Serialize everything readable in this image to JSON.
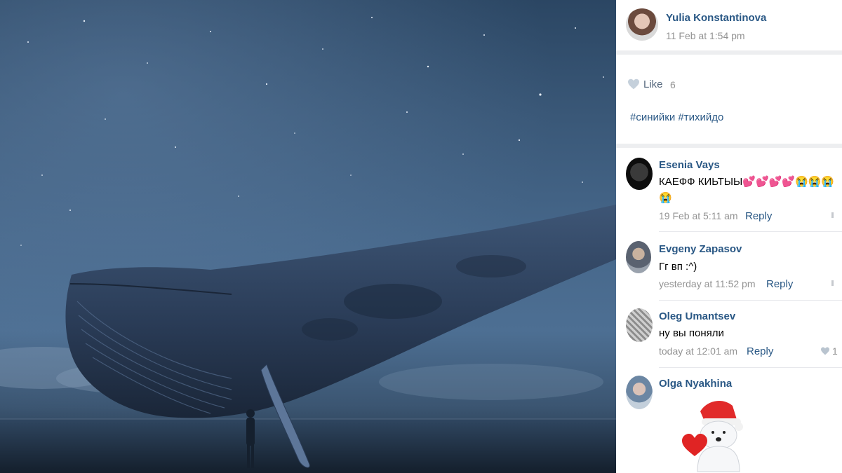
{
  "post": {
    "author": "Yulia Konstantinova",
    "timestamp": "11 Feb at 1:54 pm",
    "like_label": "Like",
    "like_count": "6",
    "hashtags": "#синийки #тихийдо"
  },
  "comments": [
    {
      "author": "Esenia Vays",
      "text": "КАЕФФ КИЬТЫЫ💕💕💕💕😭😭😭",
      "line2": "😭",
      "time": "19 Feb at 5:11 am",
      "reply": "Reply",
      "likes": ""
    },
    {
      "author": "Evgeny Zapasov",
      "text": "Гг вп :^)",
      "time": "yesterday at 11:52 pm",
      "reply": "Reply",
      "likes": ""
    },
    {
      "author": "Oleg Umantsev",
      "text": "ну вы поняли",
      "time": "today at 12:01 am",
      "reply": "Reply",
      "likes": "1"
    },
    {
      "author": "Olga Nyakhina",
      "sticker": "polar-bear-sticker"
    }
  ],
  "colors": {
    "link": "#2a5885",
    "meta": "#939393",
    "heart": "#c5d0db",
    "sky": "#3a5878",
    "whale": "#2c3f5b"
  }
}
